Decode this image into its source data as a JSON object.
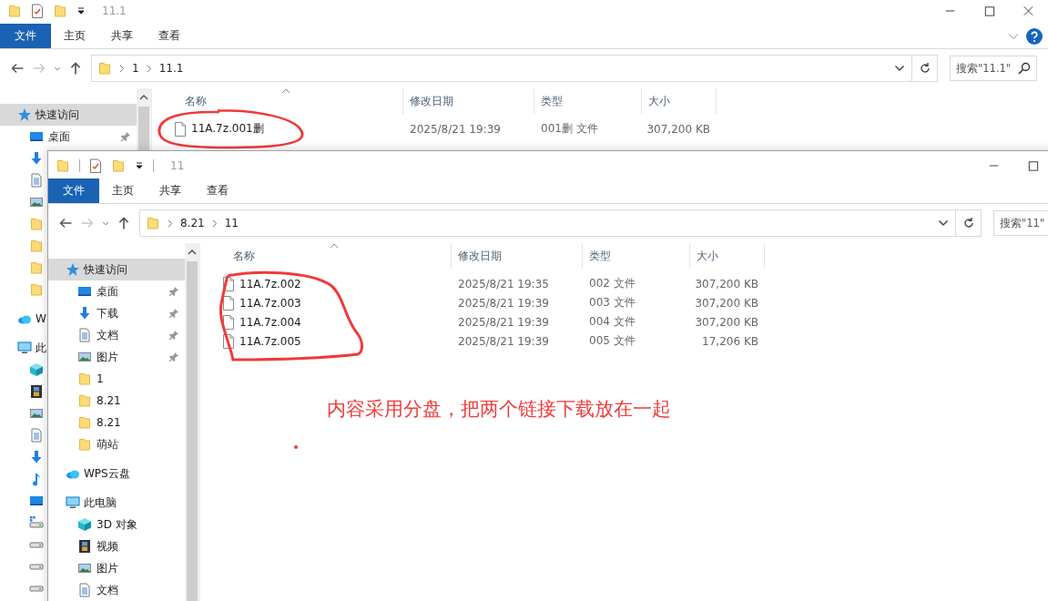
{
  "back_window": {
    "title": "11.1",
    "quick_access_separators": false,
    "window_controls": [
      {
        "kind": "minimize"
      },
      {
        "kind": "maximize"
      },
      {
        "kind": "close"
      }
    ],
    "ribbon_help": true,
    "ribbon_tabs": [
      {
        "label": "文件",
        "selected": true
      },
      {
        "label": "主页",
        "selected": false
      },
      {
        "label": "共享",
        "selected": false
      },
      {
        "label": "查看",
        "selected": false
      }
    ],
    "path": [
      "1",
      "11.1"
    ],
    "search": {
      "placeholder": "搜索\"11.1\""
    },
    "sidebar": [
      {
        "kind": "star",
        "label": "快速访问",
        "selected": true,
        "children": [
          {
            "kind": "desktop",
            "label": "桌面",
            "pinned": true,
            "selected": false
          },
          {
            "kind": "download",
            "pinned": false,
            "selected": false
          },
          {
            "kind": "document",
            "pinned": false,
            "selected": false
          },
          {
            "kind": "pictures",
            "pinned": false,
            "selected": false
          },
          {
            "kind": "folder",
            "pinned": false,
            "selected": false
          },
          {
            "kind": "folder",
            "pinned": false,
            "selected": false
          },
          {
            "kind": "folder",
            "pinned": false,
            "selected": false
          },
          {
            "kind": "folder",
            "pinned": false,
            "selected": false
          }
        ]
      },
      {
        "kind": "cloud",
        "label": "W",
        "selected": false
      },
      {
        "kind": "pc",
        "label": "此",
        "selected": false,
        "children": [
          {
            "kind": "cube",
            "selected": false
          },
          {
            "kind": "video",
            "selected": false
          },
          {
            "kind": "pictures",
            "selected": false
          },
          {
            "kind": "document",
            "selected": false
          },
          {
            "kind": "download",
            "selected": false
          },
          {
            "kind": "music",
            "selected": false
          },
          {
            "kind": "desktop",
            "selected": false
          },
          {
            "kind": "drivewin",
            "selected": false
          },
          {
            "kind": "drive",
            "selected": false
          },
          {
            "kind": "drive",
            "selected": false
          },
          {
            "kind": "drive",
            "selected": false
          }
        ]
      }
    ],
    "columns": [
      "名称",
      "修改日期",
      "类型",
      "大小"
    ],
    "files": [
      {
        "name": "11A.7z.001删",
        "date": "2025/8/21 19:39",
        "type": "001删 文件",
        "size": "307,200 KB"
      }
    ]
  },
  "front_window": {
    "title": "11",
    "quick_access_separators": true,
    "window_controls": [
      {
        "kind": "minimize"
      },
      {
        "kind": "maximize"
      }
    ],
    "ribbon_tabs": [
      {
        "label": "文件",
        "selected": true
      },
      {
        "label": "主页",
        "selected": false
      },
      {
        "label": "共享",
        "selected": false
      },
      {
        "label": "查看",
        "selected": false
      }
    ],
    "path": [
      "8.21",
      "11"
    ],
    "search": {
      "placeholder": "搜索\"11\""
    },
    "sidebar": [
      {
        "kind": "star",
        "label": "快速访问",
        "selected": true,
        "children": [
          {
            "kind": "desktop",
            "label": "桌面",
            "pinned": true,
            "selected": false
          },
          {
            "kind": "download",
            "label": "下载",
            "pinned": true,
            "selected": false
          },
          {
            "kind": "document",
            "label": "文档",
            "pinned": true,
            "selected": false
          },
          {
            "kind": "pictures",
            "label": "图片",
            "pinned": true,
            "selected": false
          },
          {
            "kind": "folder",
            "label": "1",
            "pinned": false,
            "selected": false
          },
          {
            "kind": "folder",
            "label": "8.21",
            "pinned": false,
            "selected": false
          },
          {
            "kind": "folder",
            "label": "8.21",
            "pinned": false,
            "selected": false
          },
          {
            "kind": "folder",
            "label": "萌站",
            "pinned": false,
            "selected": false
          }
        ]
      },
      {
        "kind": "cloud",
        "label": "WPS云盘",
        "selected": false
      },
      {
        "kind": "pc",
        "label": "此电脑",
        "selected": false,
        "children": [
          {
            "kind": "cube",
            "label": "3D 对象",
            "selected": false
          },
          {
            "kind": "video",
            "label": "视频",
            "selected": false
          },
          {
            "kind": "pictures",
            "label": "图片",
            "selected": false
          },
          {
            "kind": "document",
            "label": "文档",
            "selected": false
          }
        ]
      }
    ],
    "columns": [
      "名称",
      "修改日期",
      "类型",
      "大小"
    ],
    "files": [
      {
        "name": "11A.7z.002",
        "date": "2025/8/21 19:35",
        "type": "002 文件",
        "size": "307,200 KB"
      },
      {
        "name": "11A.7z.003",
        "date": "2025/8/21 19:39",
        "type": "003 文件",
        "size": "307,200 KB"
      },
      {
        "name": "11A.7z.004",
        "date": "2025/8/21 19:39",
        "type": "004 文件",
        "size": "307,200 KB"
      },
      {
        "name": "11A.7z.005",
        "date": "2025/8/21 19:39",
        "type": "005 文件",
        "size": "17,206 KB"
      }
    ]
  },
  "annotation": {
    "text": "内容采用分盘，把两个链接下载放在一起"
  }
}
